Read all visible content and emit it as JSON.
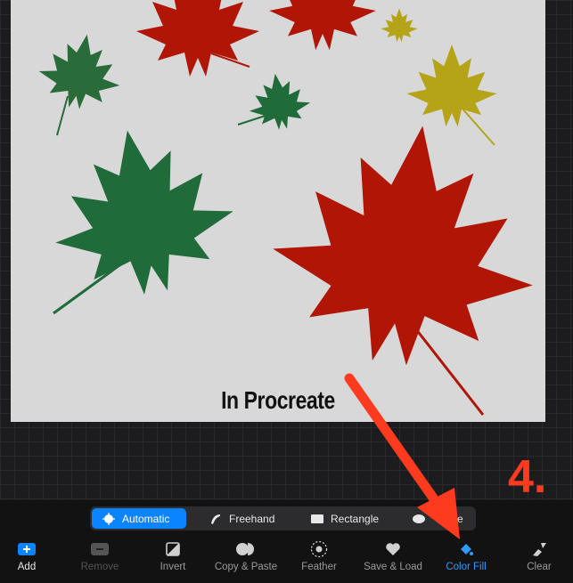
{
  "canvas": {
    "caption": "In Procreate",
    "background": "#d8d8d8",
    "leaf_colors": {
      "red": "#b01506",
      "green": "#1f6b3a",
      "yellow": "#b5a418"
    }
  },
  "annotation": {
    "step": "4.",
    "color": "#ff3b1f"
  },
  "selection_modes": {
    "items": [
      {
        "label": "Automatic",
        "icon": "sun-burst-icon",
        "active": true
      },
      {
        "label": "Freehand",
        "icon": "freehand-pen-icon",
        "active": false
      },
      {
        "label": "Rectangle",
        "icon": "rectangle-icon",
        "active": false
      },
      {
        "label": "Ellipse",
        "icon": "ellipse-icon",
        "active": false
      }
    ],
    "ellipse_visible_text": "e"
  },
  "toolbar": {
    "items": [
      {
        "label": "Add",
        "icon": "plus-icon",
        "state": "highlight"
      },
      {
        "label": "Remove",
        "icon": "minus-icon",
        "state": "disabled"
      },
      {
        "label": "Invert",
        "icon": "invert-icon",
        "state": "normal"
      },
      {
        "label": "Copy & Paste",
        "icon": "copy-paste-icon",
        "state": "normal"
      },
      {
        "label": "Feather",
        "icon": "feather-icon",
        "state": "normal"
      },
      {
        "label": "Save & Load",
        "icon": "heart-icon",
        "state": "normal"
      },
      {
        "label": "Color Fill",
        "icon": "color-fill-icon",
        "state": "active"
      },
      {
        "label": "Clear",
        "icon": "brush-icon",
        "state": "normal"
      }
    ]
  },
  "accent": "#0a84ff"
}
